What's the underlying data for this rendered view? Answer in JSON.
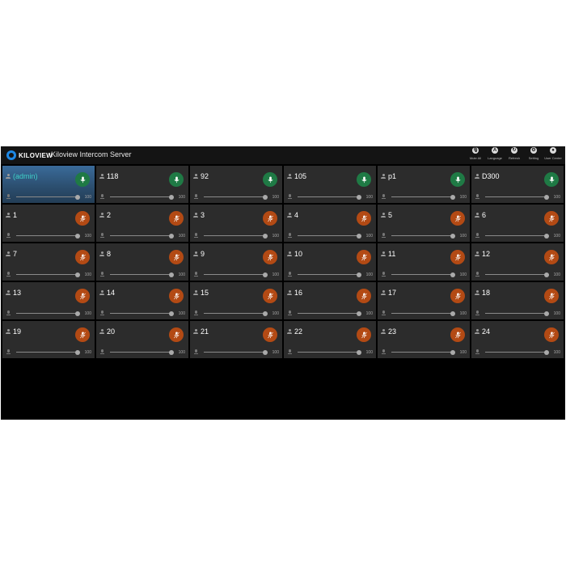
{
  "header": {
    "logo_text": "KILOVIEW",
    "title": "Kiloview Intercom Server",
    "tools": [
      {
        "icon": "mute-all-icon",
        "label": "Mute All",
        "glyph": "🎙"
      },
      {
        "icon": "language-icon",
        "label": "Language",
        "glyph": "A"
      },
      {
        "icon": "refresh-icon",
        "label": "Refresh",
        "glyph": "↻"
      },
      {
        "icon": "setting-icon",
        "label": "Setting",
        "glyph": "⚙"
      },
      {
        "icon": "user-center-icon",
        "label": "User Center",
        "glyph": "●"
      }
    ]
  },
  "colors": {
    "mic_on": "#1f7a45",
    "mic_muted": "#b34a14",
    "selected_name": "#3fd0c8",
    "tile_bg": "#2c2c2c"
  },
  "tiles": [
    {
      "name": "(admin)",
      "mic": "on",
      "volume": 100,
      "selected": true
    },
    {
      "name": "118",
      "mic": "on",
      "volume": 100
    },
    {
      "name": "92",
      "mic": "on",
      "volume": 100
    },
    {
      "name": "105",
      "mic": "on",
      "volume": 100
    },
    {
      "name": "p1",
      "mic": "on",
      "volume": 100
    },
    {
      "name": "D300",
      "mic": "on",
      "volume": 100
    },
    {
      "name": "1",
      "mic": "muted",
      "volume": 100
    },
    {
      "name": "2",
      "mic": "muted",
      "volume": 100
    },
    {
      "name": "3",
      "mic": "muted",
      "volume": 100
    },
    {
      "name": "4",
      "mic": "muted",
      "volume": 100
    },
    {
      "name": "5",
      "mic": "muted",
      "volume": 100
    },
    {
      "name": "6",
      "mic": "muted",
      "volume": 100
    },
    {
      "name": "7",
      "mic": "muted",
      "volume": 100
    },
    {
      "name": "8",
      "mic": "muted",
      "volume": 100
    },
    {
      "name": "9",
      "mic": "muted",
      "volume": 100
    },
    {
      "name": "10",
      "mic": "muted",
      "volume": 100
    },
    {
      "name": "11",
      "mic": "muted",
      "volume": 100
    },
    {
      "name": "12",
      "mic": "muted",
      "volume": 100
    },
    {
      "name": "13",
      "mic": "muted",
      "volume": 100
    },
    {
      "name": "14",
      "mic": "muted",
      "volume": 100
    },
    {
      "name": "15",
      "mic": "muted",
      "volume": 100
    },
    {
      "name": "16",
      "mic": "muted",
      "volume": 100
    },
    {
      "name": "17",
      "mic": "muted",
      "volume": 100
    },
    {
      "name": "18",
      "mic": "muted",
      "volume": 100
    },
    {
      "name": "19",
      "mic": "muted",
      "volume": 100
    },
    {
      "name": "20",
      "mic": "muted",
      "volume": 100
    },
    {
      "name": "21",
      "mic": "muted",
      "volume": 100
    },
    {
      "name": "22",
      "mic": "muted",
      "volume": 100
    },
    {
      "name": "23",
      "mic": "muted",
      "volume": 100
    },
    {
      "name": "24",
      "mic": "muted",
      "volume": 100
    }
  ]
}
